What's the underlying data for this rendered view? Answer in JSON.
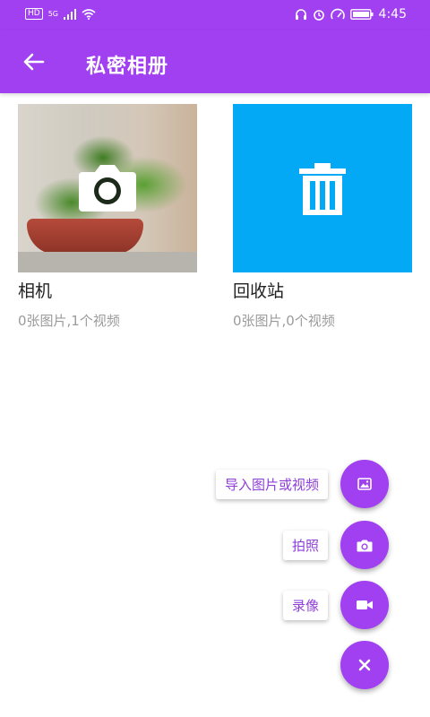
{
  "status_bar": {
    "network": "HD",
    "signal_label": "5G",
    "time": "4:45"
  },
  "app_bar": {
    "title": "私密相册"
  },
  "albums": [
    {
      "name": "相机",
      "meta": "0张图片,1个视频"
    },
    {
      "name": "回收站",
      "meta": "0张图片,0个视频"
    }
  ],
  "fab_menu": {
    "import_label": "导入图片或视频",
    "photo_label": "拍照",
    "record_label": "录像"
  },
  "colors": {
    "accent": "#a040f0",
    "trash_tile": "#03a9f4"
  },
  "icons": [
    "back-arrow-icon",
    "camera-icon",
    "trash-icon",
    "image-icon",
    "video-icon",
    "close-icon"
  ]
}
